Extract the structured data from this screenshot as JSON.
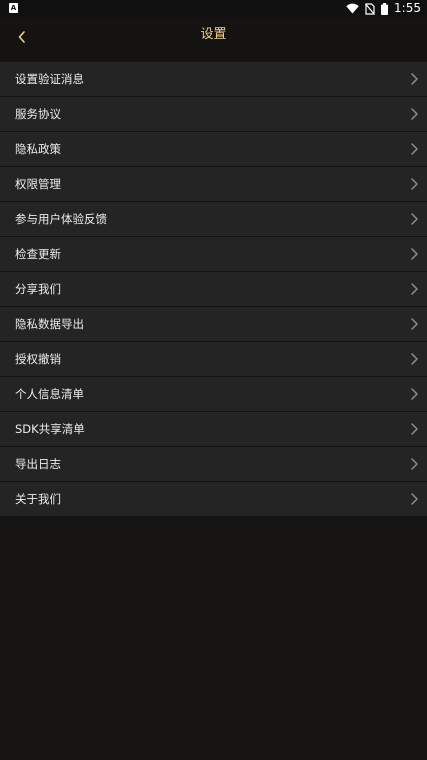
{
  "status_bar": {
    "left_badge": "A",
    "time": "1:55",
    "icons": [
      "wifi-icon",
      "no-sim-icon",
      "battery-icon"
    ]
  },
  "app_bar": {
    "title": "设置",
    "back_icon": "chevron-left-icon"
  },
  "colors": {
    "background": "#151413",
    "row_background": "#242424",
    "title_accent": "#f4cf8e",
    "row_text": "#ededed",
    "chevron": "#8e8e8e"
  },
  "settings_items": [
    {
      "label": "设置验证消息"
    },
    {
      "label": "服务协议"
    },
    {
      "label": "隐私政策"
    },
    {
      "label": "权限管理"
    },
    {
      "label": "参与用户体验反馈"
    },
    {
      "label": "检查更新"
    },
    {
      "label": "分享我们"
    },
    {
      "label": "隐私数据导出"
    },
    {
      "label": "授权撤销"
    },
    {
      "label": "个人信息清单"
    },
    {
      "label": "SDK共享清单"
    },
    {
      "label": "导出日志"
    },
    {
      "label": "关于我们"
    }
  ]
}
